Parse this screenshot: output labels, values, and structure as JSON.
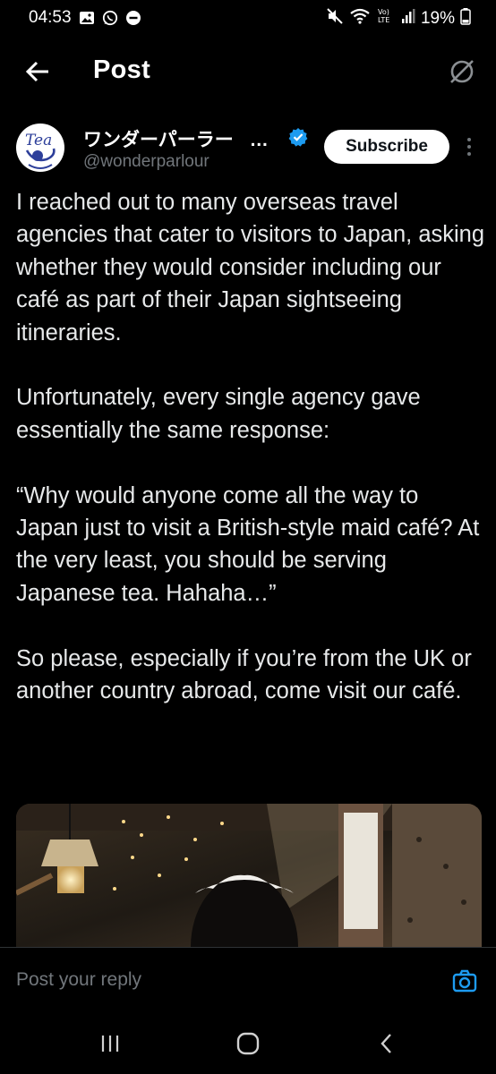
{
  "status_bar": {
    "time": "04:53",
    "battery": "19%",
    "icons": [
      "gallery-icon",
      "whatsapp-icon",
      "dnd-icon",
      "mute-icon",
      "wifi-icon",
      "volte-icon",
      "signal-icon",
      "battery-icon"
    ],
    "volte_label": "Vo)\nLTE"
  },
  "header": {
    "title": "Post",
    "back_icon": "arrow-left-icon",
    "grok_icon": "grok-icon"
  },
  "author": {
    "name": "ワンダーパーラー",
    "name_suffix": "…",
    "handle": "@wonderparlour",
    "verified": true,
    "avatar_text": "Tea",
    "subscribe_label": "Subscribe"
  },
  "post": {
    "paragraphs": [
      "I reached out to many overseas travel agencies that cater to visitors to Japan, asking whether they would consider including our café as part of their Japan sightseeing itineraries.",
      "Unfortunately, every single agency gave essentially the same response:",
      "“Why would anyone come all the way to Japan just to visit a British-style maid café? At the very least, you should be serving Japanese tea. Hahaha…”",
      "So please, especially if you’re from the UK or another country abroad, come visit our café."
    ]
  },
  "reply": {
    "placeholder": "Post your reply",
    "camera_icon": "camera-icon"
  },
  "nav": {
    "recents_icon": "recents-icon",
    "home_icon": "home-icon",
    "back_icon": "back-chevron-icon"
  },
  "colors": {
    "background": "#000000",
    "text": "#e7e9ea",
    "muted": "#71767b",
    "accent": "#1d9bf0"
  }
}
